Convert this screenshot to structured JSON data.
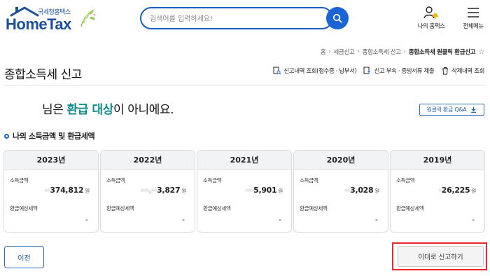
{
  "header": {
    "logo_sub": "국세청홈택스",
    "logo_main": "HomeTax",
    "search_placeholder": "검색어를 입력하세요!",
    "my_home_label": "나의 홈택스",
    "all_menu_label": "전체메뉴"
  },
  "breadcrumb": {
    "items": [
      "홈",
      "세금신고",
      "종합소득세 신고"
    ],
    "current": "종합소득세 원클릭 환급신고"
  },
  "page": {
    "title": "종합소득세 신고",
    "links": [
      "신고내역 조회(접수증 · 납부서)",
      "신고 부속 · 증빙서류 제출",
      "삭제내역 조회"
    ]
  },
  "message": {
    "prefix": "님은 ",
    "highlight": "환급 대상",
    "suffix": "이 아니에요."
  },
  "qa_button": "원클릭 환급 Q&A",
  "section_title": "나의 소득금액 및 환급세액",
  "cards": [
    {
      "year": "2023년",
      "income_label": "소득금액",
      "income_masked": "",
      "income_visible": "374,812",
      "unit": "원",
      "refund_label": "환급예상세액",
      "refund": "-"
    },
    {
      "year": "2022년",
      "income_label": "소득금액",
      "income_masked": "",
      "income_visible": "3,827",
      "unit": "원",
      "refund_label": "환급예상세액",
      "refund": "-"
    },
    {
      "year": "2021년",
      "income_label": "소득금액",
      "income_masked": "",
      "income_visible": "5,901",
      "unit": "원",
      "refund_label": "환급예상세액",
      "refund": "-"
    },
    {
      "year": "2020년",
      "income_label": "소득금액",
      "income_masked": "",
      "income_visible": "3,028",
      "unit": "원",
      "refund_label": "환급예상세액",
      "refund": "-"
    },
    {
      "year": "2019년",
      "income_label": "소득금액",
      "income_masked": "",
      "income_visible": "26,225",
      "unit": "원",
      "refund_label": "환급예상세액",
      "refund": "-"
    }
  ],
  "buttons": {
    "prev": "이전",
    "file_as_is": "이대로 신고하기"
  },
  "colors": {
    "brand_blue": "#1a64d6",
    "highlight_teal": "#138a8a",
    "focus_red": "#e8262b"
  }
}
